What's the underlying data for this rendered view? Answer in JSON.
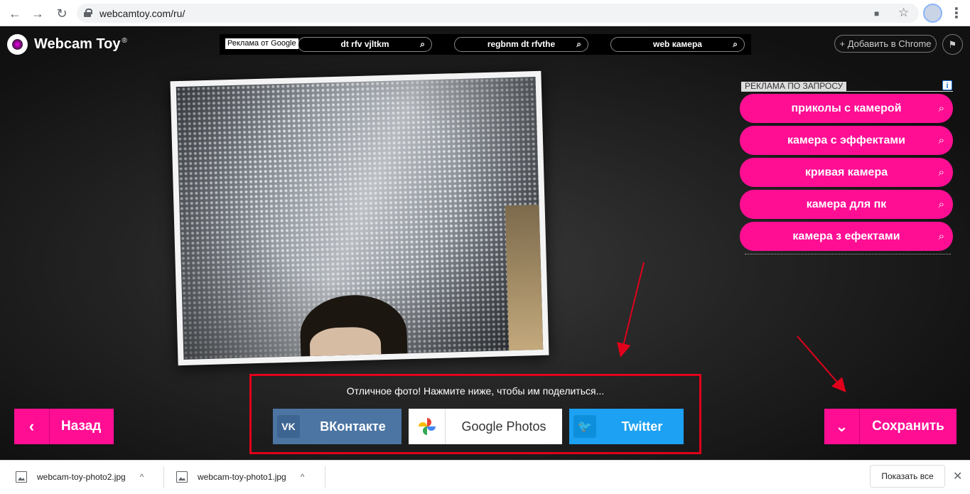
{
  "browser": {
    "url": "webcamtoy.com/ru/",
    "back_glyph": "←",
    "forward_glyph": "→",
    "reload_glyph": "↻",
    "camera_glyph": "■",
    "star_glyph": "☆",
    "menu_glyph": "⋮"
  },
  "site": {
    "logo_text": "Webcam Toy",
    "logo_mark": "®",
    "add_to_chrome": "+ Добавить в Chrome",
    "flag_glyph": "⚑"
  },
  "top_ads": {
    "label": "Реклама от Google",
    "pills": [
      "dt rfv vjltkm",
      "regbnm dt rfvthe",
      "web камера"
    ],
    "search_glyph": "⌕"
  },
  "side_ads": {
    "header": "РЕКЛАМА ПО ЗАПРОСУ",
    "info_glyph": "i",
    "items": [
      "приколы с камерой",
      "камера с эффектами",
      "кривая камера",
      "камера для пк",
      "камера з ефектами"
    ]
  },
  "share": {
    "message": "Отличное фото! Нажмите ниже, чтобы им поделиться...",
    "vk_label": "ВКонтакте",
    "vk_icon_text": "VK",
    "gphotos_label": "Google Photos",
    "twitter_label": "Twitter",
    "twitter_glyph": "🐦"
  },
  "actions": {
    "back_label": "Назад",
    "back_glyph": "‹",
    "save_label": "Сохранить",
    "save_glyph": "⌄"
  },
  "downloads": {
    "files": [
      "webcam-toy-photo2.jpg",
      "webcam-toy-photo1.jpg"
    ],
    "caret_glyph": "^",
    "show_all": "Показать все",
    "close_glyph": "✕"
  },
  "colors": {
    "accent_pink": "#ff0e94",
    "vk_blue": "#4c75a3",
    "twitter_blue": "#1da1f2",
    "annotation_red": "#e0001b"
  }
}
